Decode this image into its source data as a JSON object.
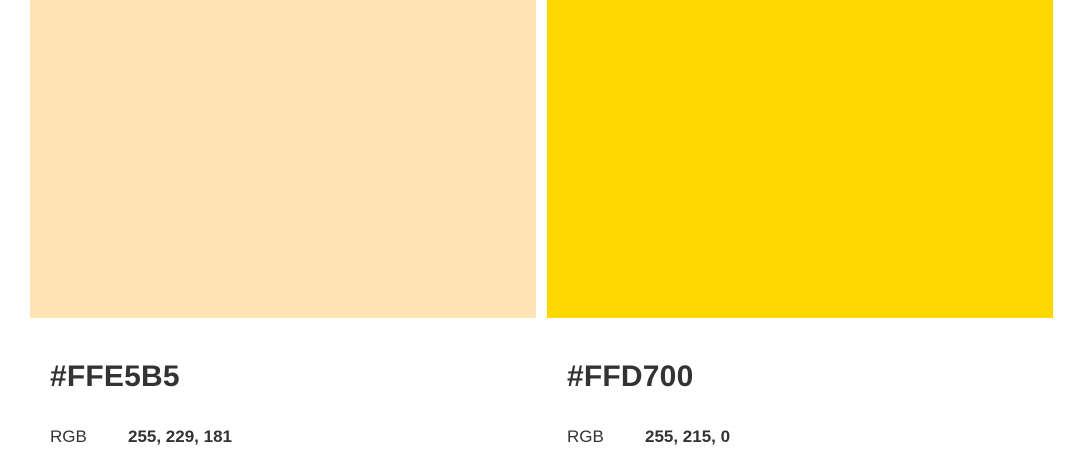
{
  "swatches": [
    {
      "color": "#FFE5B5",
      "hex_label": "#FFE5B5",
      "rgb_label": "RGB",
      "rgb_value": "255, 229, 181"
    },
    {
      "color": "#FFD700",
      "hex_label": "#FFD700",
      "rgb_label": "RGB",
      "rgb_value": "255, 215, 0"
    }
  ]
}
